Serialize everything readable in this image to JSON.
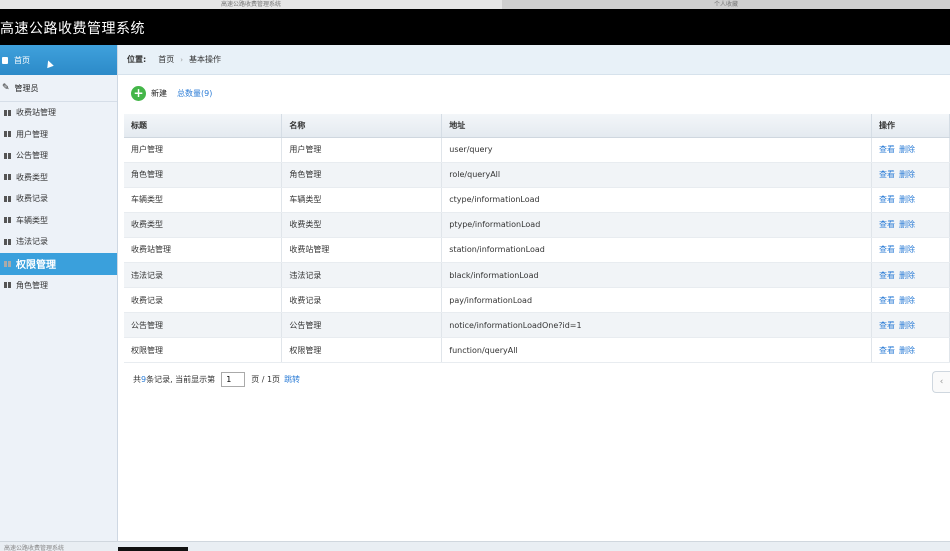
{
  "browser_tabs": [
    "高速公路收费管理系统",
    "个人收藏"
  ],
  "app": {
    "title": "高速公路收费管理系统"
  },
  "sidebar": {
    "home": "首页",
    "section": "管理员",
    "items": [
      {
        "label": "收费站管理",
        "active": false
      },
      {
        "label": "用户管理",
        "active": false
      },
      {
        "label": "公告管理",
        "active": false
      },
      {
        "label": "收费类型",
        "active": false
      },
      {
        "label": "收费记录",
        "active": false
      },
      {
        "label": "车辆类型",
        "active": false
      },
      {
        "label": "违法记录",
        "active": false
      },
      {
        "label": "权限管理",
        "active": true
      },
      {
        "label": "角色管理",
        "active": false
      }
    ]
  },
  "breadcrumb": {
    "label": "位置:",
    "items": [
      "首页",
      "基本操作"
    ],
    "separator": "›"
  },
  "toolbar": {
    "new_label": "新建",
    "count_label": "总数量(9)"
  },
  "table": {
    "headers": [
      "标题",
      "名称",
      "地址",
      "操作"
    ],
    "rows": [
      [
        "用户管理",
        "用户管理",
        "user/query"
      ],
      [
        "角色管理",
        "角色管理",
        "role/queryAll"
      ],
      [
        "车辆类型",
        "车辆类型",
        "ctype/informationLoad"
      ],
      [
        "收费类型",
        "收费类型",
        "ptype/informationLoad"
      ],
      [
        "收费站管理",
        "收费站管理",
        "station/informationLoad"
      ],
      [
        "违法记录",
        "违法记录",
        "black/informationLoad"
      ],
      [
        "收费记录",
        "收费记录",
        "pay/informationLoad"
      ],
      [
        "公告管理",
        "公告管理",
        "notice/informationLoadOne?id=1"
      ],
      [
        "权限管理",
        "权限管理",
        "function/queryAll"
      ]
    ],
    "view_label": "查看",
    "delete_label": "删除"
  },
  "pager": {
    "prefix": "共",
    "total": "9",
    "mid": "条记录,  当前显示第",
    "page": "1",
    "suffix": "页 / 1页",
    "jump": "跳转",
    "prev": "‹"
  },
  "taskbar": {
    "item": "高速公路收费管理系统"
  },
  "colors": {
    "accent": "#3aa0dc",
    "link": "#2b7cd6",
    "header_bg": "#000000",
    "add_green": "#44b649"
  }
}
